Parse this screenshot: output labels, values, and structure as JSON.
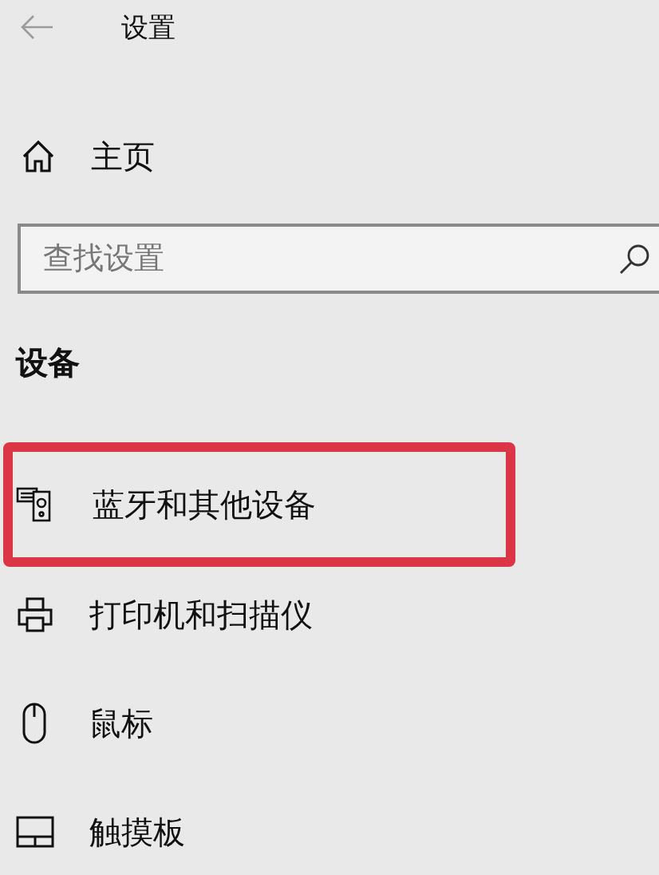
{
  "window": {
    "title": "设置"
  },
  "home": {
    "label": "主页"
  },
  "search": {
    "placeholder": "查找设置"
  },
  "section": {
    "title": "设备"
  },
  "nav_items": [
    {
      "kind": "bluetooth",
      "label": "蓝牙和其他设备",
      "highlighted": true
    },
    {
      "kind": "printer",
      "label": "打印机和扫描仪",
      "highlighted": false
    },
    {
      "kind": "mouse",
      "label": "鼠标",
      "highlighted": false
    },
    {
      "kind": "touchpad",
      "label": "触摸板",
      "highlighted": false
    }
  ]
}
